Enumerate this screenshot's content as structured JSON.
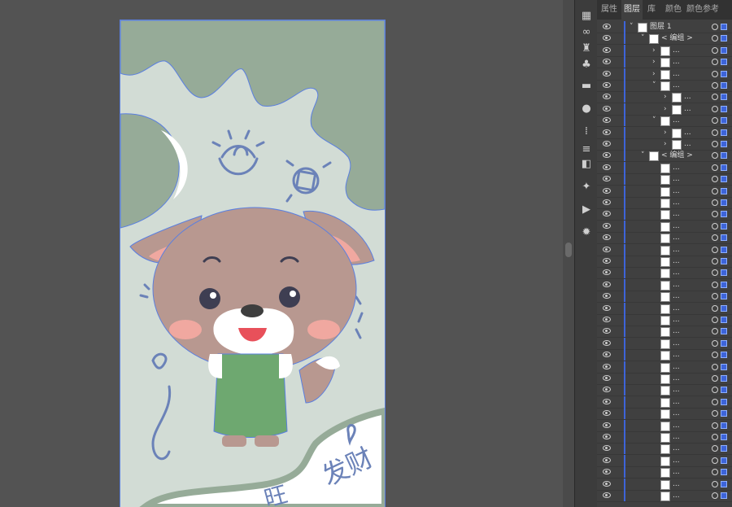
{
  "tabs": [
    {
      "label": "属性",
      "active": false
    },
    {
      "label": "图层",
      "active": true
    },
    {
      "label": "库",
      "active": false
    },
    {
      "label": "颜色",
      "active": false
    },
    {
      "label": "颜色参考",
      "active": false
    }
  ],
  "layers": {
    "root_name": "图层 1",
    "group_name": "< 编组 >",
    "sub_group_name": "< 编组 >",
    "collapsed_item_label": "...",
    "colors": {
      "selection": "#3d64d9",
      "panel": "#404040",
      "canvas": "#535353"
    }
  },
  "artboard": {
    "text_right": "发财",
    "text_bottom": "旺"
  },
  "toolbar_icons": [
    "artboards-icon",
    "link-icon",
    "brush-icon",
    "club-icon",
    "gradient-icon",
    "sphere-icon",
    "grid-icon",
    "align-icon",
    "pathfinder-icon",
    "magic-wand-icon",
    "play-icon",
    "sun-icon"
  ]
}
